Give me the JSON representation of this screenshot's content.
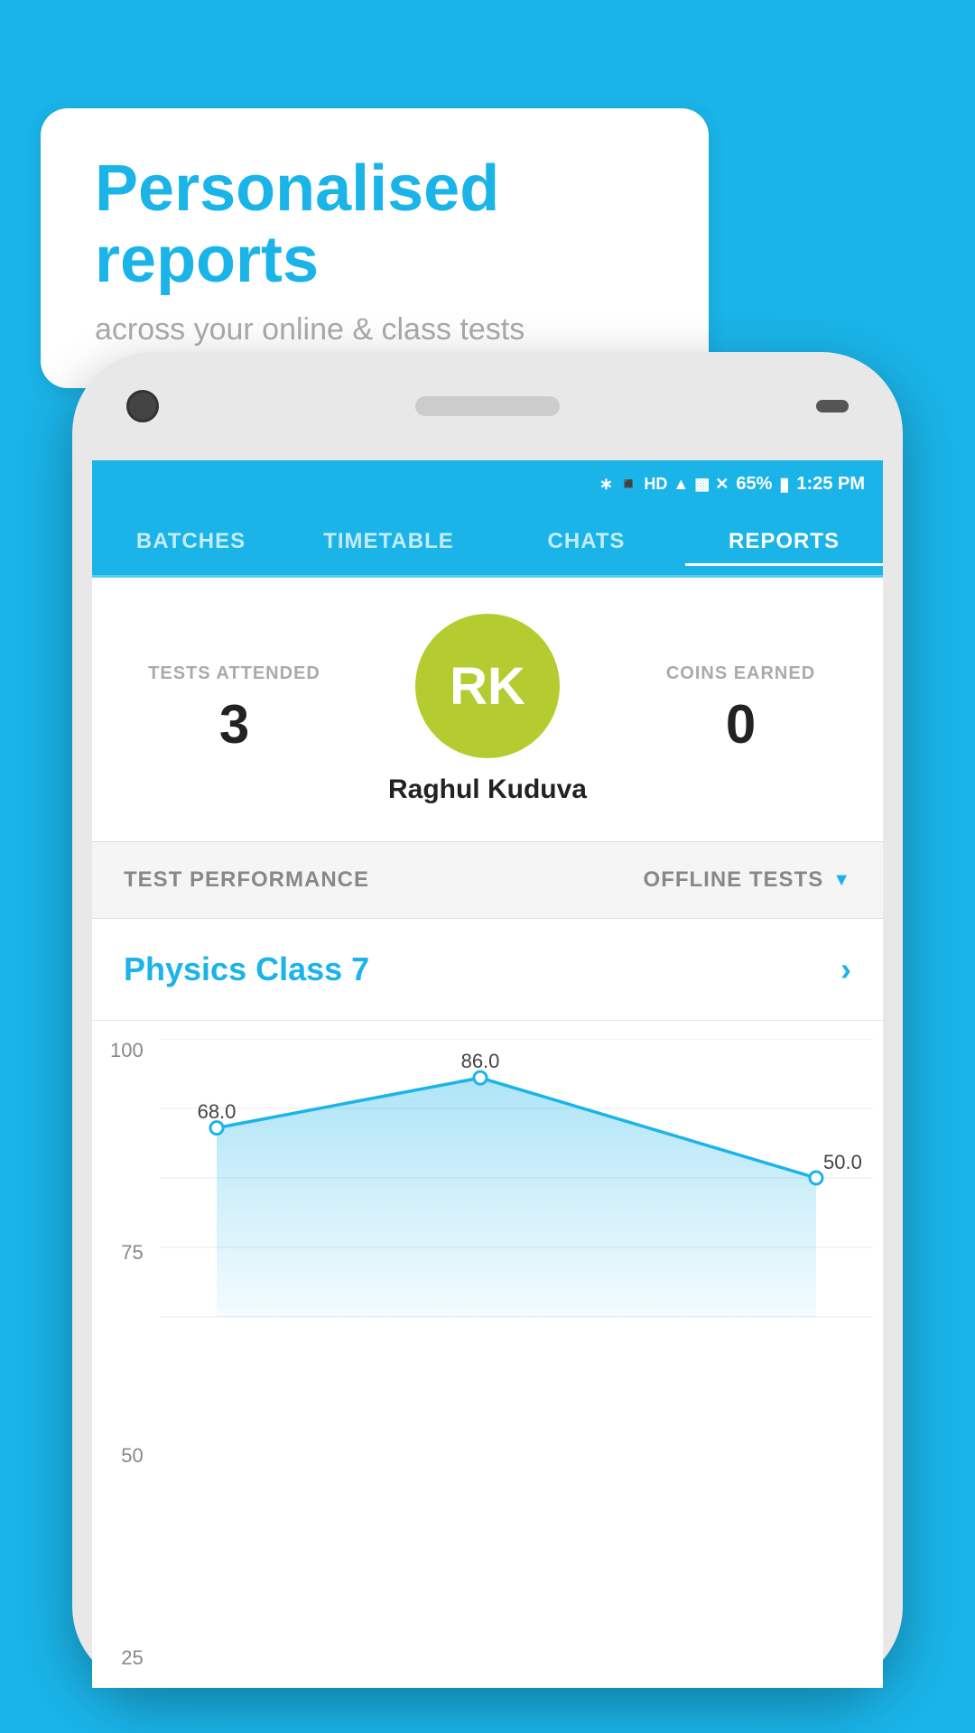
{
  "bubble": {
    "title": "Personalised reports",
    "subtitle": "across your online & class tests"
  },
  "status_bar": {
    "battery": "65%",
    "time": "1:25 PM",
    "signal": "HD"
  },
  "nav": {
    "tabs": [
      "BATCHES",
      "TIMETABLE",
      "CHATS",
      "REPORTS"
    ],
    "active": "REPORTS"
  },
  "profile": {
    "tests_attended_label": "TESTS ATTENDED",
    "tests_attended_value": "3",
    "coins_earned_label": "COINS EARNED",
    "coins_earned_value": "0",
    "avatar_initials": "RK",
    "user_name": "Raghul Kuduva"
  },
  "test_performance": {
    "label": "TEST PERFORMANCE",
    "filter_label": "OFFLINE TESTS"
  },
  "class_row": {
    "name": "Physics Class 7"
  },
  "chart": {
    "y_labels": [
      "100",
      "75",
      "50",
      "25"
    ],
    "data_points": [
      {
        "x": 0.08,
        "y": 68.0,
        "label": "68.0"
      },
      {
        "x": 0.45,
        "y": 86.0,
        "label": "86.0"
      },
      {
        "x": 0.92,
        "y": 50.0,
        "label": "50.0"
      }
    ],
    "y_min": 0,
    "y_max": 100
  }
}
